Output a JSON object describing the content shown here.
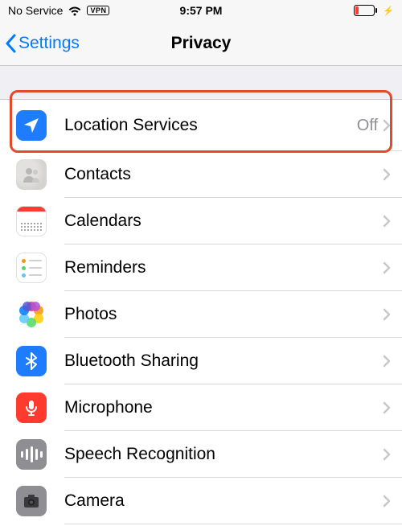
{
  "status": {
    "carrier": "No Service",
    "vpn": "VPN",
    "time": "9:57 PM",
    "charging": "⚡"
  },
  "nav": {
    "back": "Settings",
    "title": "Privacy"
  },
  "rows": [
    {
      "label": "Location Services",
      "value": "Off"
    },
    {
      "label": "Contacts"
    },
    {
      "label": "Calendars"
    },
    {
      "label": "Reminders"
    },
    {
      "label": "Photos"
    },
    {
      "label": "Bluetooth Sharing"
    },
    {
      "label": "Microphone"
    },
    {
      "label": "Speech Recognition"
    },
    {
      "label": "Camera"
    }
  ]
}
